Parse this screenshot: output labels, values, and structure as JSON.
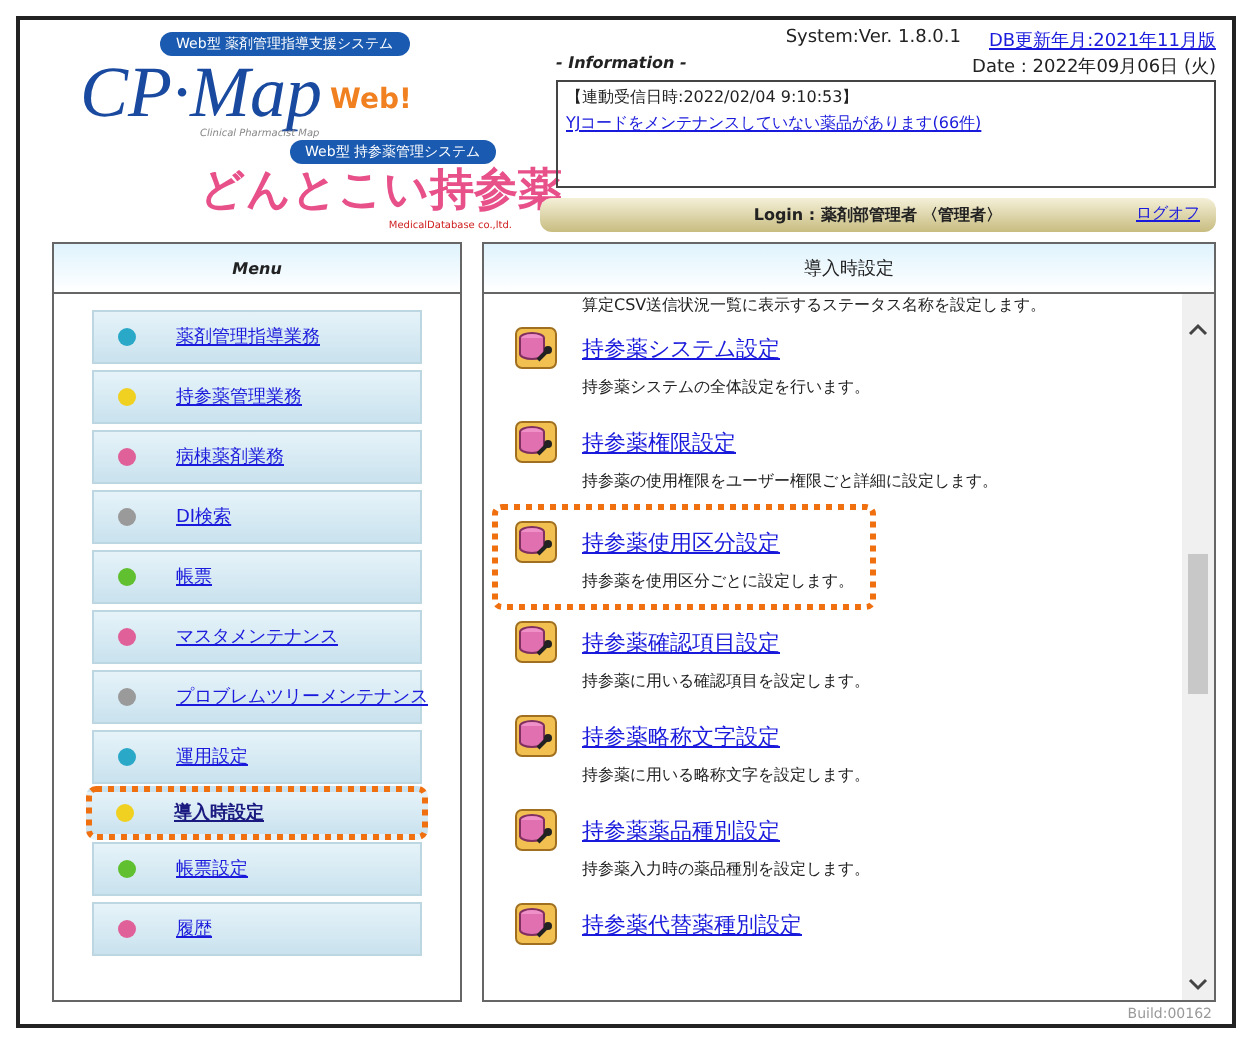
{
  "logo": {
    "tagline_top": "Web型 薬剤管理指導支援システム",
    "brand": "CP·Map",
    "brand_suffix": "Web!",
    "subtitle": "Clinical Pharmacist Map",
    "tagline_bottom": "Web型 持参薬管理システム",
    "product": "どんとこい持参薬",
    "company": "MedicalDatabase co.,ltd."
  },
  "header": {
    "system_version": "System:Ver. 1.8.0.1",
    "db_update": "DB更新年月:2021年11月版",
    "date": "Date : 2022年09月06日 (火)"
  },
  "information": {
    "label": "- Information -",
    "received": "【連動受信日時:2022/02/04 9:10:53】",
    "link": "YJコードをメンテナンスしていない薬品があります(66件)"
  },
  "login": {
    "text": "Login : 薬剤部管理者 〈管理者〉",
    "logout": "ログオフ"
  },
  "menu": {
    "title": "Menu",
    "items": [
      {
        "label": "薬剤管理指導業務",
        "color": "#2aa8c8",
        "selected": false,
        "highlighted": false
      },
      {
        "label": "持参薬管理業務",
        "color": "#f0d020",
        "selected": false,
        "highlighted": false
      },
      {
        "label": "病棟薬剤業務",
        "color": "#e0609a",
        "selected": false,
        "highlighted": false
      },
      {
        "label": "DI検索",
        "color": "#9a9a9a",
        "selected": false,
        "highlighted": false
      },
      {
        "label": "帳票",
        "color": "#60c030",
        "selected": false,
        "highlighted": false
      },
      {
        "label": "マスタメンテナンス",
        "color": "#e0609a",
        "selected": false,
        "highlighted": false
      },
      {
        "label": "プロブレムツリーメンテナンス",
        "color": "#9a9a9a",
        "selected": false,
        "highlighted": false
      },
      {
        "label": "運用設定",
        "color": "#2aa8c8",
        "selected": false,
        "highlighted": false
      },
      {
        "label": "導入時設定",
        "color": "#f0d020",
        "selected": true,
        "highlighted": true
      },
      {
        "label": "帳票設定",
        "color": "#60c030",
        "selected": false,
        "highlighted": false
      },
      {
        "label": "履歴",
        "color": "#e0609a",
        "selected": false,
        "highlighted": false
      }
    ]
  },
  "content": {
    "title": "導入時設定",
    "lead_description": "算定CSV送信状況一覧に表示するステータス名称を設定します。",
    "items": [
      {
        "label": "持参薬システム設定",
        "description": "持参薬システムの全体設定を行います。",
        "highlighted": false
      },
      {
        "label": "持参薬権限設定",
        "description": "持参薬の使用権限をユーザー権限ごと詳細に設定します。",
        "highlighted": false
      },
      {
        "label": "持参薬使用区分設定",
        "description": "持参薬を使用区分ごとに設定します。",
        "highlighted": true
      },
      {
        "label": "持参薬確認項目設定",
        "description": "持参薬に用いる確認項目を設定します。",
        "highlighted": false
      },
      {
        "label": "持参薬略称文字設定",
        "description": "持参薬に用いる略称文字を設定します。",
        "highlighted": false
      },
      {
        "label": "持参薬薬品種別設定",
        "description": "持参薬入力時の薬品種別を設定します。",
        "highlighted": false
      },
      {
        "label": "持参薬代替薬種別設定",
        "highlighted": false
      }
    ]
  },
  "build": "Build:00162"
}
